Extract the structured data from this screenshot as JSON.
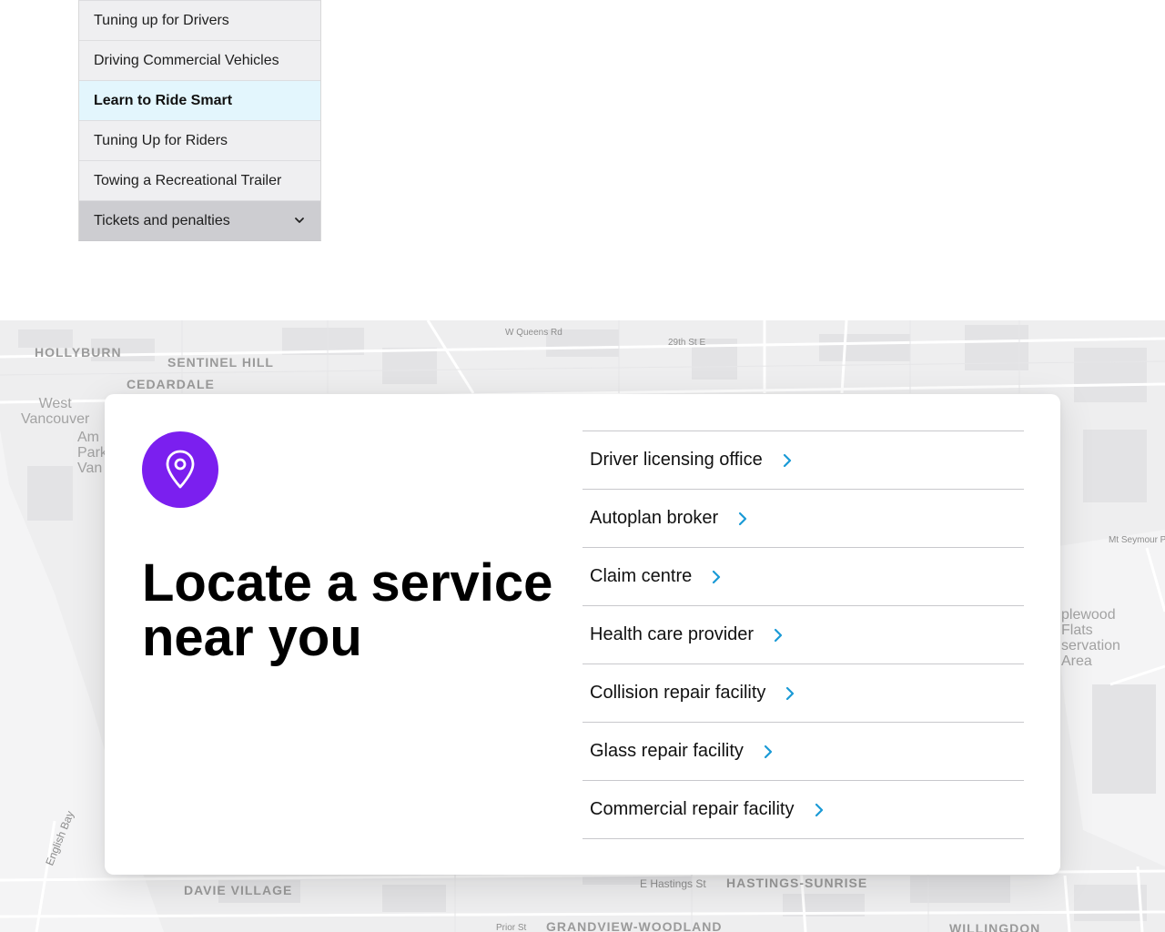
{
  "menu": {
    "items": [
      {
        "label": "Tuning up for Drivers",
        "state": "normal"
      },
      {
        "label": "Driving Commercial Vehicles",
        "state": "normal"
      },
      {
        "label": "Learn to Ride Smart",
        "state": "active"
      },
      {
        "label": "Tuning Up for Riders",
        "state": "normal"
      },
      {
        "label": "Towing a Recreational Trailer",
        "state": "normal"
      },
      {
        "label": "Tickets and penalties",
        "state": "expandable"
      }
    ],
    "expand_icon": "chevron-down-icon"
  },
  "map": {
    "labels": {
      "hollyburn": "HOLLYBURN",
      "sentinel_hill": "SENTINEL HILL",
      "cedardale": "CEDARDALE",
      "west_vancouver": "West\nVancouver",
      "ambleside": "Am\nPark\nVan",
      "w_queens_rd": "W Queens Rd",
      "st_29th": "29th St E",
      "mt_seymour": "Mt Seymour P",
      "maplewood": "plewood\nFlats\nservation\nArea",
      "davie_village": "DAVIE VILLAGE",
      "hastings_sunrise": "HASTINGS-SUNRISE",
      "e_hastings": "E Hastings St",
      "grandview": "GRANDVIEW-WOODLAND",
      "willingdon": "WILLINGDON",
      "english_bay": "English Bay",
      "prior_st": "Prior St"
    }
  },
  "card": {
    "icon": "location-pin-icon",
    "title": "Locate a service near you",
    "accent_color": "#7b1fef",
    "arrow_color": "#1a9ad6",
    "services": [
      {
        "label": "Driver licensing office"
      },
      {
        "label": "Autoplan broker"
      },
      {
        "label": "Claim centre"
      },
      {
        "label": "Health care provider"
      },
      {
        "label": "Collision repair facility"
      },
      {
        "label": "Glass repair facility"
      },
      {
        "label": "Commercial repair facility"
      }
    ]
  }
}
